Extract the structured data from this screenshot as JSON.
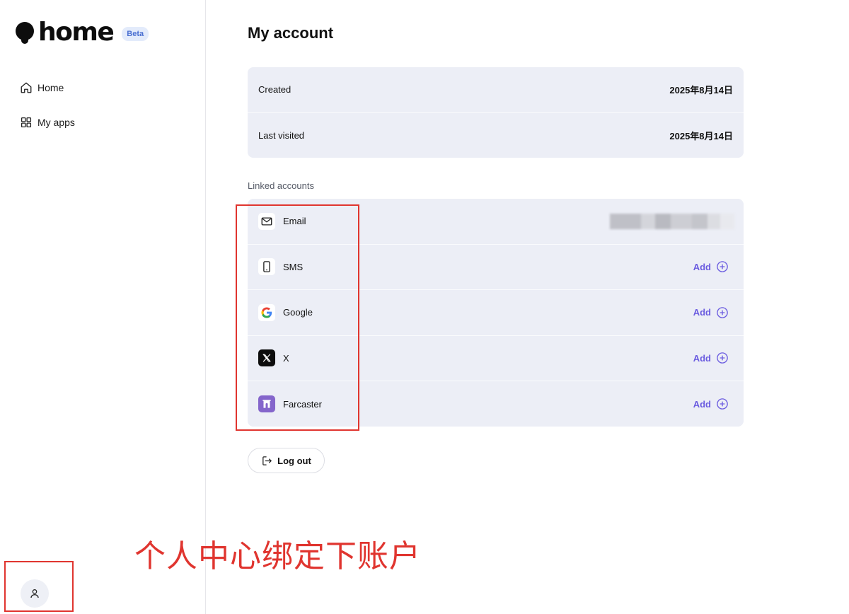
{
  "sidebar": {
    "logo_text": "home",
    "beta_badge": "Beta",
    "nav": [
      {
        "label": "Home",
        "icon": "home-icon"
      },
      {
        "label": "My apps",
        "icon": "grid-icon"
      }
    ],
    "profile_icon": "user-icon"
  },
  "main": {
    "title": "My account",
    "info_rows": [
      {
        "label": "Created",
        "value": "2025年8月14日"
      },
      {
        "label": "Last visited",
        "value": "2025年8月14日"
      }
    ],
    "linked_label": "Linked accounts",
    "linked_accounts": [
      {
        "name": "Email",
        "icon": "mail-icon",
        "status": "linked (redacted)"
      },
      {
        "name": "SMS",
        "icon": "phone-icon",
        "action": "Add"
      },
      {
        "name": "Google",
        "icon": "google-icon",
        "action": "Add"
      },
      {
        "name": "X",
        "icon": "x-logo-icon",
        "action": "Add"
      },
      {
        "name": "Farcaster",
        "icon": "farcaster-icon",
        "action": "Add"
      }
    ],
    "logout_label": "Log out"
  },
  "annotation": {
    "caption": "个人中心绑定下账户",
    "color": "#e0352f"
  },
  "colors": {
    "accent": "#6b5ce0",
    "card_bg": "#eceef6",
    "beta_bg": "#e3ebfb",
    "beta_text": "#4a6fd1"
  }
}
